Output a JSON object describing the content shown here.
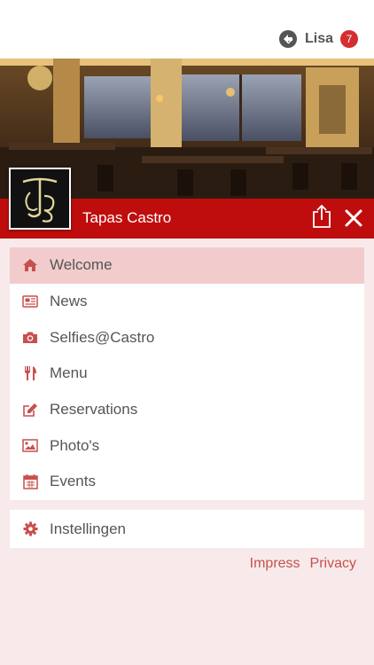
{
  "user": {
    "name": "Lisa",
    "notification_count": "7",
    "icon": "account-switch-icon"
  },
  "venue": {
    "name": "Tapas Castro",
    "logo_text": "TCB"
  },
  "header_actions": {
    "share_icon": "share-icon",
    "close_icon": "close-icon"
  },
  "menu": {
    "items": [
      {
        "label": "Welcome",
        "icon": "home-icon",
        "active": true
      },
      {
        "label": "News",
        "icon": "newspaper-icon",
        "active": false
      },
      {
        "label": "Selfies@Castro",
        "icon": "camera-icon",
        "active": false
      },
      {
        "label": "Menu",
        "icon": "cutlery-icon",
        "active": false
      },
      {
        "label": "Reservations",
        "icon": "edit-icon",
        "active": false
      },
      {
        "label": "Photo's",
        "icon": "image-icon",
        "active": false
      },
      {
        "label": "Events",
        "icon": "calendar-icon",
        "active": false
      }
    ]
  },
  "settings": {
    "label": "Instellingen",
    "icon": "gear-icon"
  },
  "footer": {
    "impress": "Impress",
    "privacy": "Privacy"
  },
  "colors": {
    "brand": "#bf0d0d",
    "accent": "#c6504e",
    "active_bg": "#f2cccc",
    "background": "#f8eaea"
  }
}
